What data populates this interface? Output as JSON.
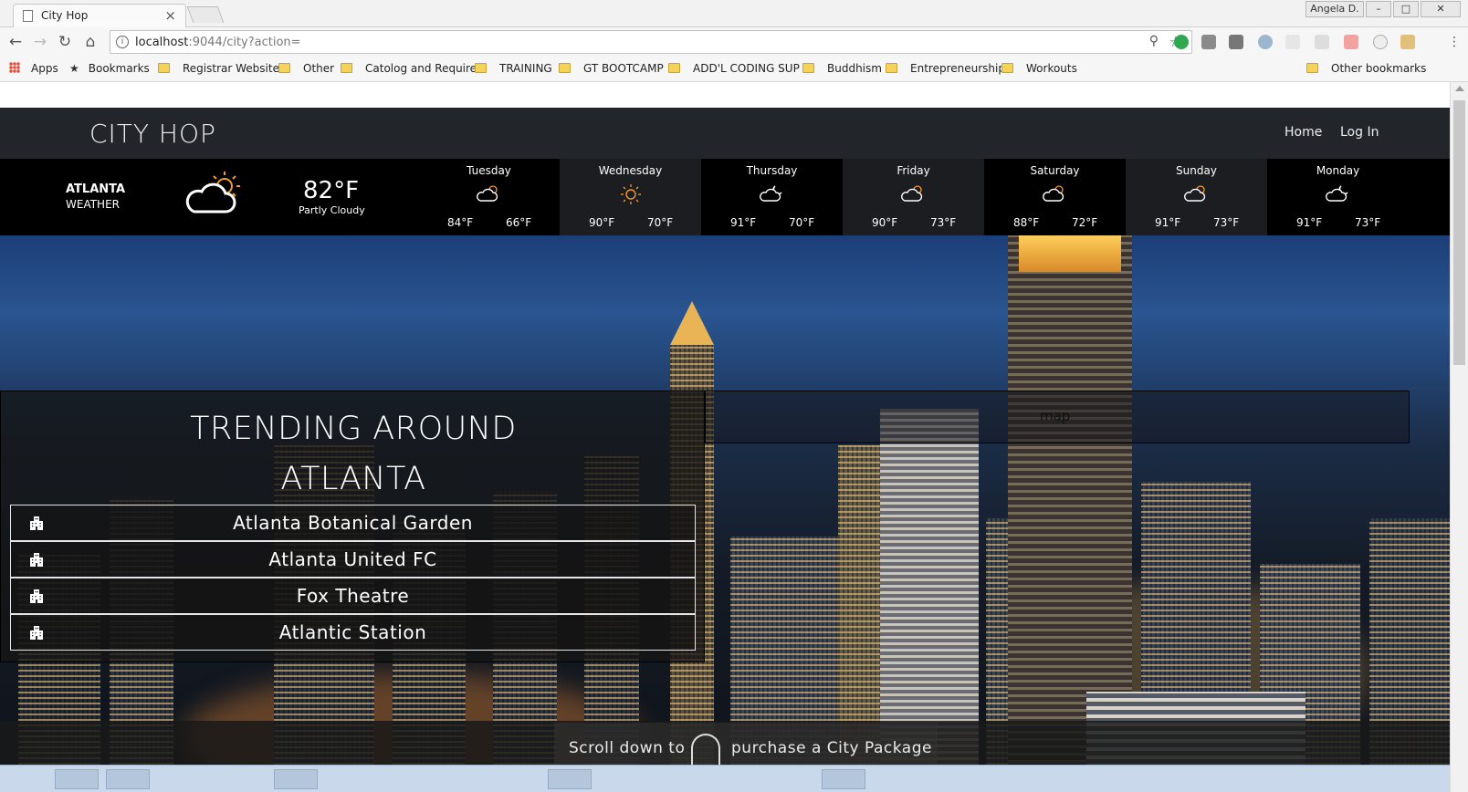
{
  "browser": {
    "tab_title": "City Hop",
    "tab_close": "×",
    "user_name": "Angela D.",
    "window_buttons": [
      "–",
      "□",
      "✕"
    ],
    "url_host": "localhost",
    "url_rest": ":9044/city?action=",
    "bookmarks": [
      "Apps",
      "Bookmarks",
      "Registrar Websites",
      "Other",
      "Catolog and Require",
      "TRAINING",
      "GT BOOTCAMP",
      "ADD'L CODING SUP",
      "Buddhism",
      "Entrepreneurship",
      "Workouts"
    ],
    "other_bookmarks": "Other bookmarks"
  },
  "site": {
    "brand": "CITY HOP",
    "nav": [
      "Home",
      "Log In"
    ]
  },
  "weather": {
    "city": "ATLANTA",
    "label": "WEATHER",
    "temp": "82°F",
    "condition": "Partly Cloudy",
    "forecast": [
      {
        "day": "Tuesday",
        "hi": "84°F",
        "lo": "66°F",
        "icon": "partly-cloudy-icon"
      },
      {
        "day": "Wednesday",
        "hi": "90°F",
        "lo": "70°F",
        "icon": "sun-icon"
      },
      {
        "day": "Thursday",
        "hi": "91°F",
        "lo": "70°F",
        "icon": "cloud-moon-icon"
      },
      {
        "day": "Friday",
        "hi": "90°F",
        "lo": "73°F",
        "icon": "partly-cloudy-icon"
      },
      {
        "day": "Saturday",
        "hi": "88°F",
        "lo": "72°F",
        "icon": "partly-cloudy-icon"
      },
      {
        "day": "Sunday",
        "hi": "91°F",
        "lo": "73°F",
        "icon": "partly-cloudy-icon"
      },
      {
        "day": "Monday",
        "hi": "91°F",
        "lo": "73°F",
        "icon": "cloud-moon-icon"
      }
    ]
  },
  "trending": {
    "title_line1": "TRENDING AROUND",
    "title_line2": "ATLANTA",
    "places": [
      "Atlanta Botanical Garden",
      "Atlanta United FC",
      "Fox Theatre",
      "Atlantic Station"
    ]
  },
  "map": {
    "placeholder": "map"
  },
  "footer": {
    "scroll_before": "Scroll down to",
    "scroll_after": "purchase a City Package"
  }
}
